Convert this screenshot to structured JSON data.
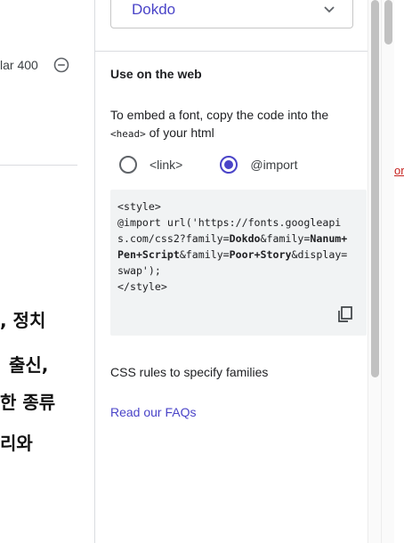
{
  "background": {
    "style_label": "lar 400",
    "korean_lines": [
      ", 정치",
      "출신,",
      "한 종류",
      "리와"
    ],
    "right_edge_text": "or"
  },
  "drawer": {
    "font_select": {
      "value": "Dokdo"
    },
    "section_title": "Use on the web",
    "embed_text_before": "To embed a font, copy the code into the",
    "embed_text_tag": "<head>",
    "embed_text_after": " of your html",
    "radio_options": [
      {
        "label": "<link>",
        "checked": false
      },
      {
        "label": "@import",
        "checked": true
      }
    ],
    "code": {
      "line1": "<style>",
      "line2a": "@import url('https://fonts.googleapi",
      "line3a": "s.com/css2?family=",
      "line3b": "Dokdo",
      "line3c": "&family=",
      "line3d": "Nanum+",
      "line4a": "Pen+Script",
      "line4b": "&family=",
      "line4c": "Poor+Story",
      "line4d": "&display=",
      "line5": "swap');",
      "line6": "</style>"
    },
    "css_rules_label": "CSS rules to specify families",
    "faq_link": "Read our FAQs"
  },
  "colors": {
    "accent": "#4a44c8",
    "code_bg": "#f1f3f4"
  }
}
